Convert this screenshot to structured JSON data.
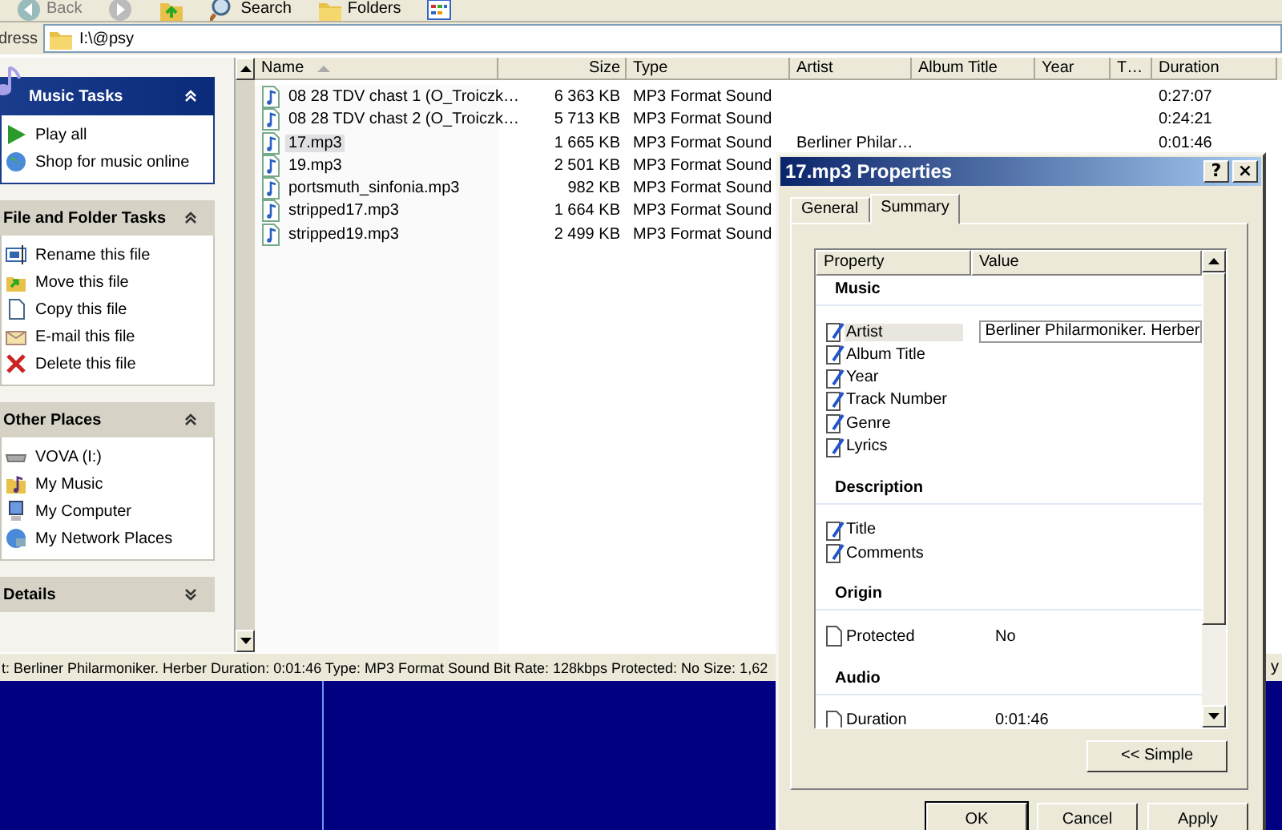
{
  "toolbar": {
    "buttons": [
      {
        "kind": "back",
        "label": "Back"
      },
      {
        "kind": "forward"
      },
      {
        "kind": "up"
      },
      {
        "kind": "search",
        "label": "Search"
      },
      {
        "kind": "folders",
        "label": "Folders"
      },
      {
        "kind": "views"
      }
    ]
  },
  "address": {
    "label": "dress",
    "value": "I:\\@psy"
  },
  "task_pane": [
    {
      "title": "Music Tasks",
      "expanded": true,
      "items": [
        {
          "label": "Play all"
        },
        {
          "label": "Shop for music online"
        }
      ]
    },
    {
      "title": "File and Folder Tasks",
      "expanded": true,
      "items": [
        {
          "label": "Rename this file"
        },
        {
          "label": "Move this file"
        },
        {
          "label": "Copy this file"
        },
        {
          "label": "E-mail this file"
        },
        {
          "label": "Delete this file"
        }
      ]
    },
    {
      "title": "Other Places",
      "expanded": true,
      "items": [
        {
          "label": "VOVA (I:)"
        },
        {
          "label": "My Music"
        },
        {
          "label": "My Computer"
        },
        {
          "label": "My Network Places"
        }
      ]
    },
    {
      "title": "Details",
      "expanded": false
    }
  ],
  "file_list": {
    "columns": [
      "Name",
      "Size",
      "Type",
      "Artist",
      "Album Title",
      "Year",
      "T…",
      "Duration"
    ],
    "rows": [
      {
        "name": "08 28 TDV chast 1 (O_Troiczk…",
        "size": "6 363 KB",
        "type": "MP3 Format Sound",
        "duration": "0:27:07",
        "selected": false
      },
      {
        "name": "08 28 TDV chast 2 (O_Troiczk…",
        "size": "5 713 KB",
        "type": "MP3 Format Sound",
        "duration": "0:24:21",
        "selected": false
      },
      {
        "name": "17.mp3",
        "size": "1 665 KB",
        "type": "MP3 Format Sound",
        "artist": "Berliner Philar…",
        "duration": "0:01:46",
        "selected": true
      },
      {
        "name": "19.mp3",
        "size": "2 501 KB",
        "type": "MP3 Format Sound",
        "selected": false
      },
      {
        "name": "portsmuth_sinfonia.mp3",
        "size": "982 KB",
        "type": "MP3 Format Sound",
        "selected": false
      },
      {
        "name": "stripped17.mp3",
        "size": "1 664 KB",
        "type": "MP3 Format Sound",
        "selected": false
      },
      {
        "name": "stripped19.mp3",
        "size": "2 499 KB",
        "type": "MP3 Format Sound",
        "selected": false
      }
    ]
  },
  "status_bar": {
    "text": "t: Berliner Philarmoniker. Herber Duration: 0:01:46 Type: MP3 Format Sound Bit Rate: 128kbps Protected: No Size: 1,62",
    "tail": "y"
  },
  "dialog": {
    "title": "17.mp3 Properties",
    "title_buttons": [
      "?",
      "×"
    ],
    "tabs": [
      {
        "label": "General",
        "selected": false
      },
      {
        "label": "Summary",
        "selected": true
      }
    ],
    "columns": [
      "Property",
      "Value"
    ],
    "groups": [
      {
        "heading": "Music",
        "items": [
          {
            "kind": "editable",
            "property": "Artist",
            "value": "Berliner Philarmoniker. Herber",
            "selected": true
          },
          {
            "kind": "editable",
            "property": "Album Title",
            "selected": false
          },
          {
            "kind": "editable",
            "property": "Year",
            "selected": false
          },
          {
            "kind": "editable",
            "property": "Track Number",
            "selected": false
          },
          {
            "kind": "editable",
            "property": "Genre",
            "selected": false
          },
          {
            "kind": "editable",
            "property": "Lyrics",
            "selected": false
          }
        ]
      },
      {
        "heading": "Description",
        "items": [
          {
            "kind": "editable",
            "property": "Title",
            "selected": false
          },
          {
            "kind": "editable",
            "property": "Comments",
            "selected": false
          }
        ]
      },
      {
        "heading": "Origin",
        "items": [
          {
            "kind": "readonly",
            "property": "Protected",
            "value": "No",
            "selected": false
          }
        ]
      },
      {
        "heading": "Audio",
        "items": [
          {
            "kind": "readonly",
            "property": "Duration",
            "value": "0:01:46",
            "selected": false
          }
        ]
      }
    ],
    "toggle_button": "<< Simple",
    "buttons": [
      "OK",
      "Cancel",
      "Apply"
    ]
  }
}
